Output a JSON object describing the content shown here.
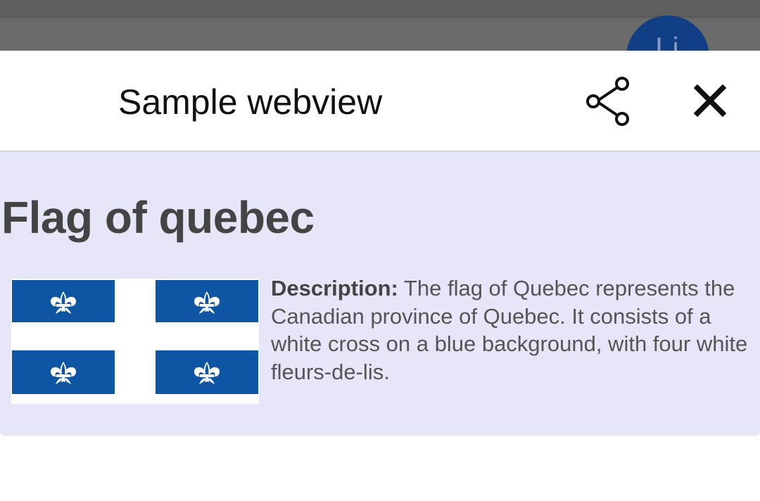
{
  "background_fab": {
    "label": "Li",
    "color": "#103f86"
  },
  "sheet": {
    "title": "Sample webview",
    "share_icon": "share-icon",
    "close_icon": "close-icon"
  },
  "webview": {
    "background_color": "#e6e6f8",
    "article": {
      "title": "Flag of quebec",
      "image": {
        "subject": "flag of Quebec",
        "colors": {
          "blue": "#0e56a4",
          "white": "#ffffff"
        }
      },
      "description_label": "Description:",
      "description_text": "The flag of Quebec represents the Canadian province of Quebec. It consists of a white cross on a blue background, with four white fleurs-de-lis."
    }
  }
}
